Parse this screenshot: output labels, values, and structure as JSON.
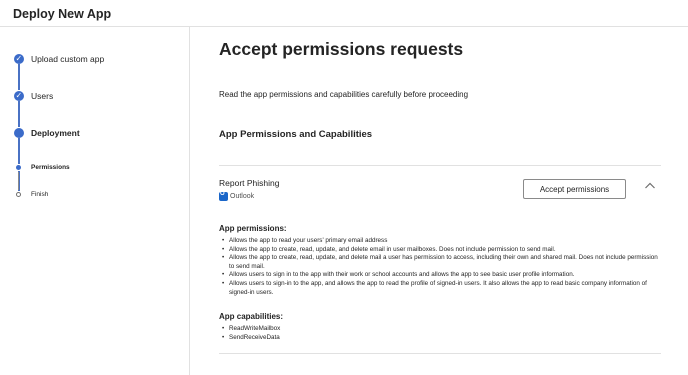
{
  "header": {
    "title": "Deploy New App"
  },
  "steps": [
    {
      "label": "Upload custom app"
    },
    {
      "label": "Users"
    },
    {
      "label": "Deployment"
    },
    {
      "label": "Permissions"
    },
    {
      "label": "Finish"
    }
  ],
  "main": {
    "title": "Accept permissions requests",
    "intro": "Read the app permissions and capabilities carefully before proceeding",
    "section_title": "App Permissions and Capabilities",
    "app": {
      "name": "Report Phishing",
      "host": "Outlook",
      "accept_label": "Accept permissions"
    },
    "permissions_title": "App permissions:",
    "permissions": [
      "Allows the app to read your users' primary email address",
      "Allows the app to create, read, update, and delete email in user mailboxes. Does not include permission to send mail.",
      "Allows the app to create, read, update, and delete mail a user has permission to access, including their own and shared mail. Does not include permission to send mail.",
      "Allows users to sign in to the app with their work or school accounts and allows the app to see basic user profile information.",
      "Allows users to sign-in to the app, and allows the app to read the profile of signed-in users. It also allows the app to read basic company information of signed-in users."
    ],
    "capabilities_title": "App capabilities:",
    "capabilities": [
      "ReadWriteMailbox",
      "SendReceiveData"
    ]
  }
}
